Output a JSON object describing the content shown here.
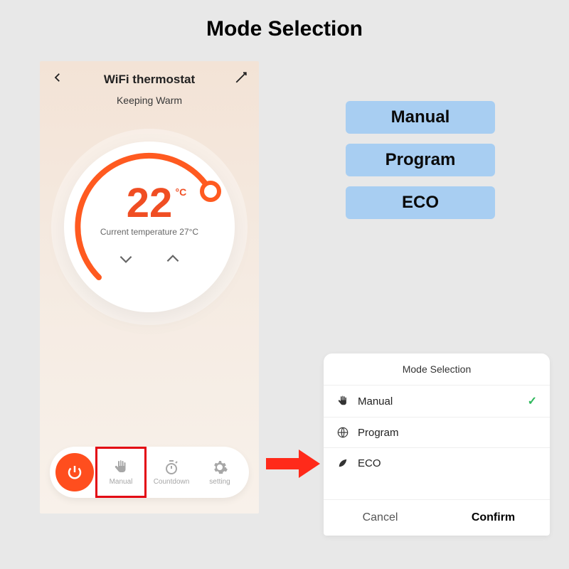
{
  "page_title": "Mode Selection",
  "phone": {
    "title": "WiFi thermostat",
    "status": "Keeping Warm",
    "temperature_value": "22",
    "temperature_unit": "°C",
    "current_temp_label": "Current temperature 27°C",
    "bottom": {
      "manual": "Manual",
      "countdown": "Countdown",
      "setting": "setting"
    }
  },
  "pills": {
    "manual": "Manual",
    "program": "Program",
    "eco": "ECO"
  },
  "sheet": {
    "title": "Mode Selection",
    "manual": "Manual",
    "program": "Program",
    "eco": "ECO",
    "cancel": "Cancel",
    "confirm": "Confirm"
  }
}
